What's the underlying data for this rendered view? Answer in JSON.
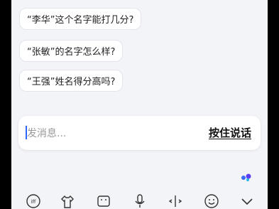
{
  "suggestions": [
    "“李华”这个名字能打几分?",
    "“张敏”的名字怎么样?",
    "“王强”姓名得分高吗?"
  ],
  "input": {
    "placeholder": "发消息...",
    "voice_label": "按住说话"
  },
  "keyboard_toolbar": {
    "icons": [
      "keyboard-switch-icon",
      "clothes-icon",
      "emoji-keyboard-icon",
      "microphone-icon",
      "cursor-move-icon",
      "smiley-icon",
      "chevron-down-icon"
    ]
  },
  "colors": {
    "background": "#f3f4f8",
    "accent": "#2c66ff"
  }
}
